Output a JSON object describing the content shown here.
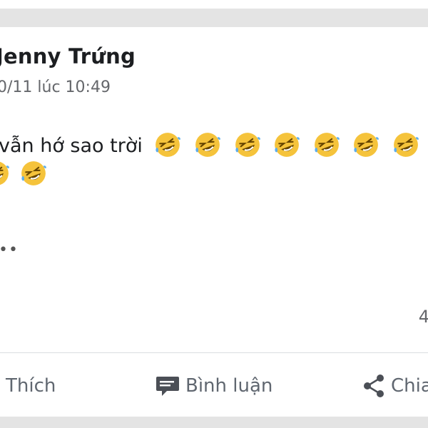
{
  "post": {
    "author": "Jenny Trứng",
    "timestamp": "0/11 lúc 10:49",
    "text": "vẫn hớ sao trời",
    "emoji": "rolling-on-the-floor-laughing",
    "more": "••",
    "reaction_count": "4"
  },
  "actions": {
    "like": "Thích",
    "comment": "Bình luận",
    "share": "Chia"
  },
  "colors": {
    "separator": "#e4e4e4",
    "secondary_text": "#65676b",
    "action_text": "#606770"
  }
}
